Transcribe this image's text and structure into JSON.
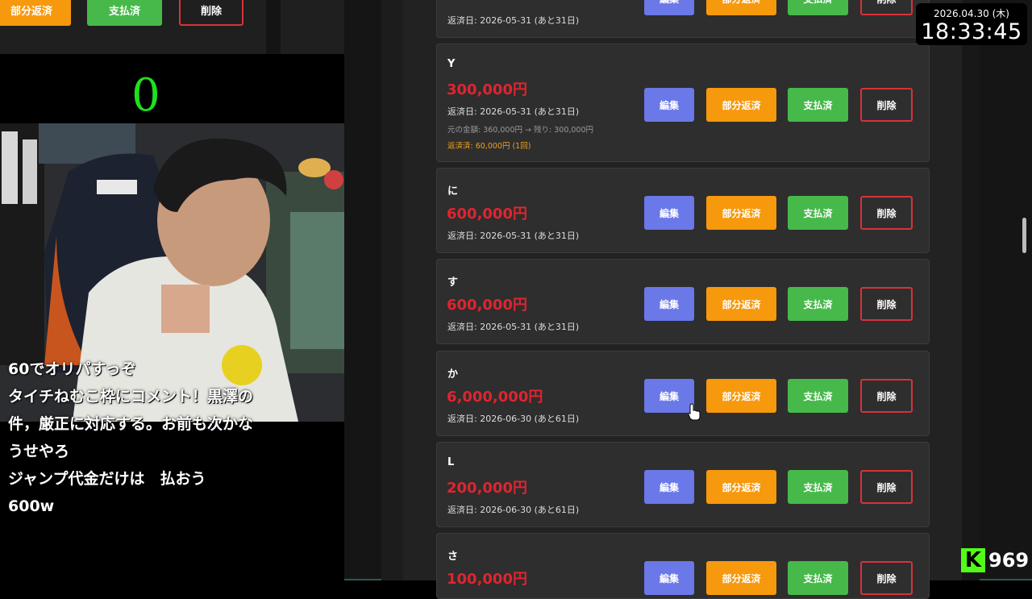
{
  "mini": {
    "buttons": [
      "部分返済",
      "支払済",
      "削除"
    ]
  },
  "counter": "0",
  "comments": [
    "60でオリパすっぞ",
    "タイチねむこ枠にコメント！黒澤の件，厳正に対応する。お前も次かな",
    "うせやろ",
    "ジャンプ代金だけは　払おう",
    "600w"
  ],
  "clock": {
    "date": "2026.04.30 (木)",
    "time": "18:33:45"
  },
  "viewers": {
    "icon": "kick-logo-icon",
    "count": "969"
  },
  "buttons": {
    "edit": "編集",
    "partial": "部分返済",
    "paid": "支払済",
    "delete": "削除"
  },
  "loans": [
    {
      "name": "",
      "amount": "",
      "due": "返済日: 2026-05-31 (あと31日)"
    },
    {
      "name": "Y",
      "amount": "300,000円",
      "due": "返済日: 2026-05-31 (あと31日)",
      "original": "元の金額: 360,000円 → 残り: 300,000円",
      "repaid": "返済済: 60,000円 (1回)"
    },
    {
      "name": "に",
      "amount": "600,000円",
      "due": "返済日: 2026-05-31 (あと31日)"
    },
    {
      "name": "す",
      "amount": "600,000円",
      "due": "返済日: 2026-05-31 (あと31日)"
    },
    {
      "name": "か",
      "amount": "6,000,000円",
      "due": "返済日: 2026-06-30 (あと61日)"
    },
    {
      "name": "L",
      "amount": "200,000円",
      "due": "返済日: 2026-06-30 (あと61日)"
    },
    {
      "name": "さ",
      "amount": "100,000円",
      "due": ""
    }
  ],
  "colors": {
    "edit": "#6b78e8",
    "partial": "#f7990c",
    "paid": "#46b94a",
    "delete": "#d7323a",
    "amount": "#e0242f",
    "counter": "#1fe01f"
  }
}
